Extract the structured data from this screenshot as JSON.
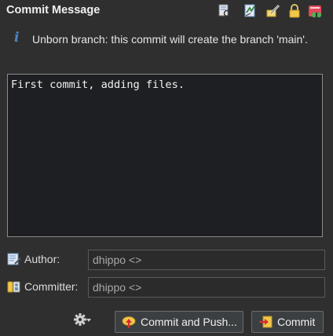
{
  "header": {
    "title": "Commit Message"
  },
  "info": {
    "icon": "info-icon",
    "message": "Unborn branch: this commit will create the branch 'main'."
  },
  "message_editor": {
    "value": "First commit, adding files."
  },
  "author": {
    "label": "Author:",
    "value": "dhippo <>"
  },
  "committer": {
    "label": "Committer:",
    "value": "dhippo <>"
  },
  "buttons": {
    "commit_and_push": "Commit and Push...",
    "commit": "Commit"
  }
}
